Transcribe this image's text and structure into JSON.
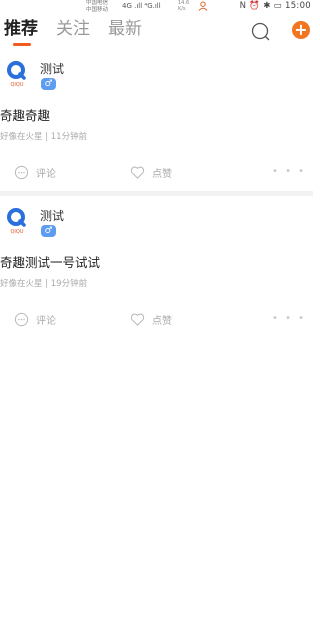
{
  "statusbar": {
    "carrier_top": "中国电信",
    "carrier_bottom": "中国移动",
    "network": "4G .ıll ⁴G.ıll",
    "speed_value": "14.6",
    "speed_unit": "K/s",
    "right_icons": "N ⏰ ✱ ▭",
    "time": "15:00"
  },
  "header": {
    "tabs": [
      {
        "label": "推荐",
        "active": true
      },
      {
        "label": "关注",
        "active": false
      },
      {
        "label": "最新",
        "active": false
      }
    ],
    "search_icon": "search-icon",
    "add_icon": "plus-icon",
    "add_label": "+",
    "accent_color": "#f25a1f"
  },
  "posts": [
    {
      "author": "测试",
      "avatar_text": "QIQU",
      "gender": "♂",
      "title": "奇趣奇趣",
      "meta": "好像在火星 | 11分钟前",
      "comment_label": "评论",
      "like_label": "点赞",
      "more_label": "• • •"
    },
    {
      "author": "测试",
      "avatar_text": "QIQU",
      "gender": "♂",
      "title": "奇趣测试一号试试",
      "meta": "好像在火星 | 19分钟前",
      "comment_label": "评论",
      "like_label": "点赞",
      "more_label": "• • •"
    }
  ]
}
